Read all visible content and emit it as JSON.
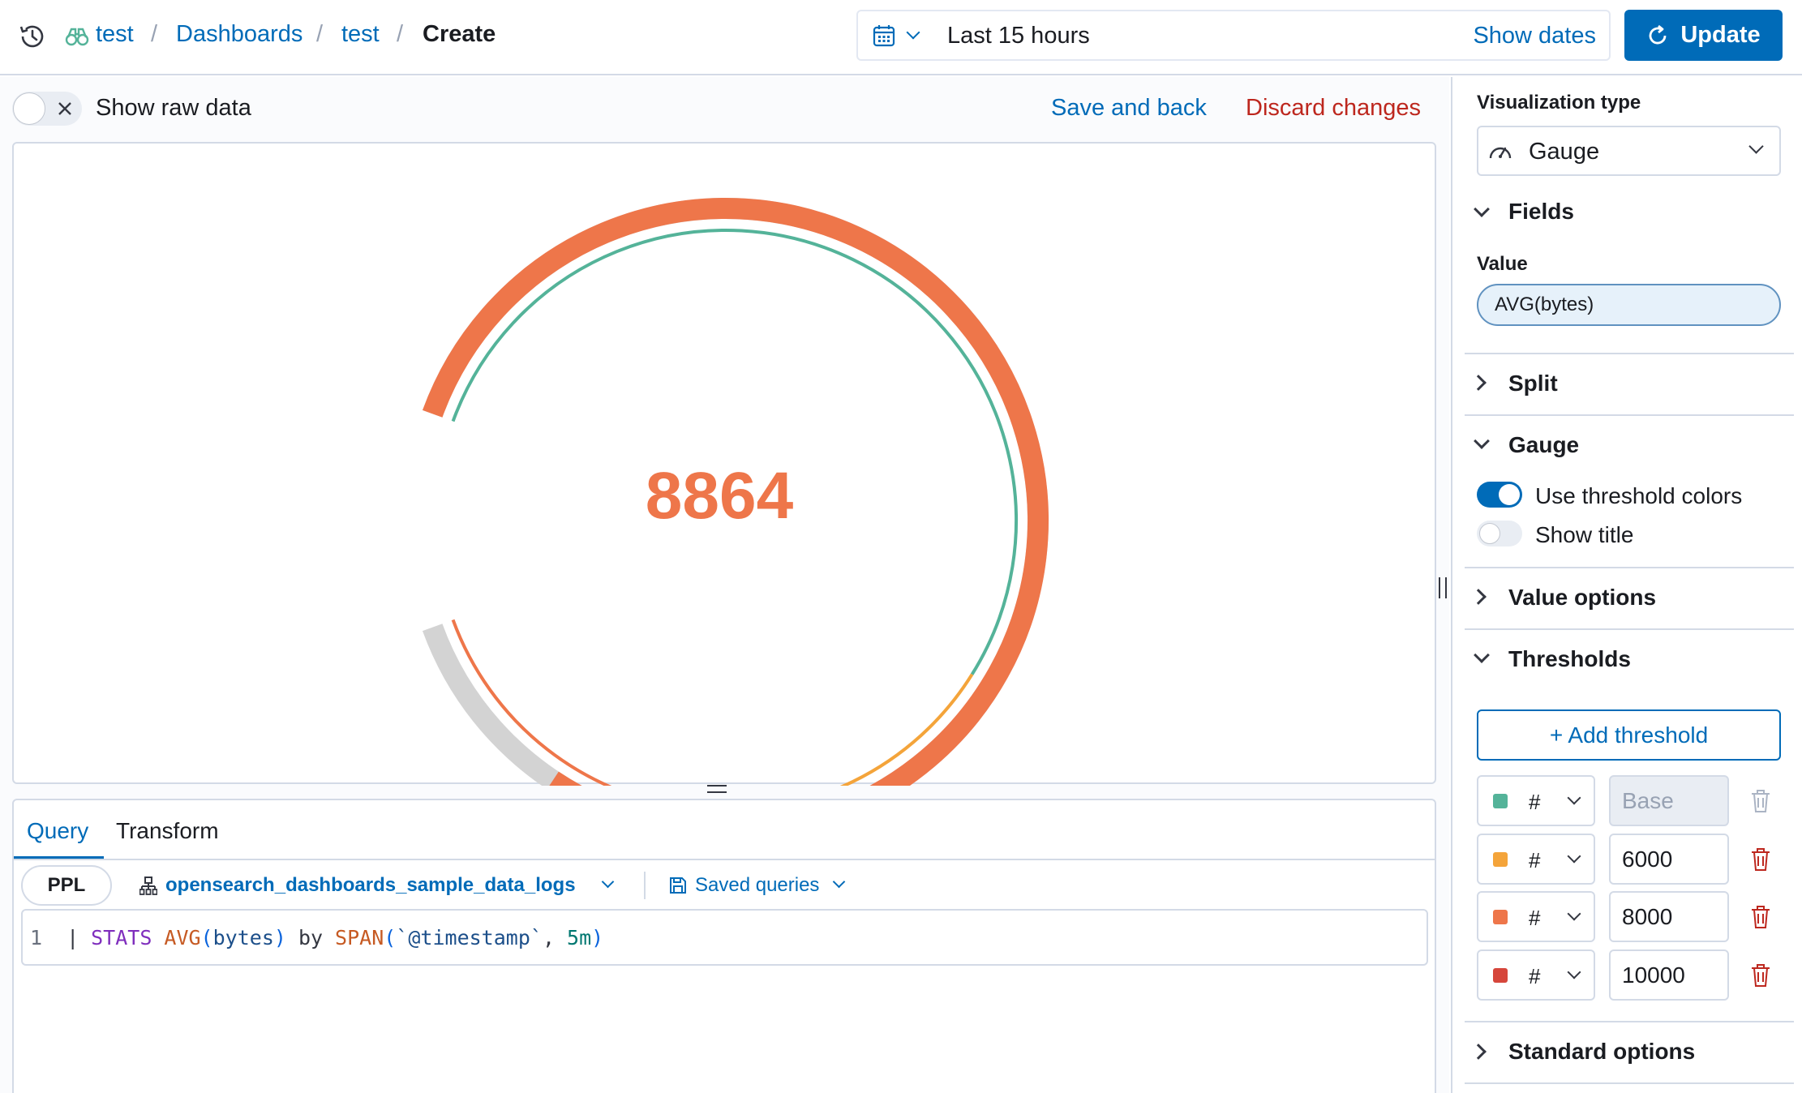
{
  "header": {
    "breadcrumbs": [
      "test",
      "Dashboards",
      "test"
    ],
    "current": "Create",
    "date_range": "Last 15 hours",
    "show_dates_label": "Show dates",
    "update_label": "Update"
  },
  "toolbar": {
    "show_raw_data_label": "Show raw data",
    "save_and_back_label": "Save and back",
    "discard_changes_label": "Discard changes"
  },
  "gauge": {
    "value": 8864,
    "display_value": "8864",
    "min": 0,
    "max": 10000,
    "value_color": "#ee764a",
    "track_color": "#d3d3d3",
    "thresholds": [
      {
        "value": 0,
        "color": "#54b399"
      },
      {
        "value": 6000,
        "color": "#f4a43a"
      },
      {
        "value": 8000,
        "color": "#ee764a"
      },
      {
        "value": 10000,
        "color": "#d6463b"
      }
    ]
  },
  "query": {
    "tabs": [
      "Query",
      "Transform"
    ],
    "active_tab": "Query",
    "language": "PPL",
    "index": "opensearch_dashboards_sample_data_logs",
    "saved_queries_label": "Saved queries",
    "line_number": "1",
    "code": {
      "pipe": "|",
      "kw1": "STATS",
      "fn1": "AVG",
      "p1": "(",
      "arg1": "bytes",
      "p2": ")",
      "by": "by",
      "fn2": "SPAN",
      "p3": "(",
      "field": "`@timestamp`",
      "comma": ",",
      "interval": "5m",
      "p4": ")"
    }
  },
  "sidebar": {
    "vis_type_label": "Visualization type",
    "vis_type_value": "Gauge",
    "fields_title": "Fields",
    "value_label": "Value",
    "value_pill": "AVG(bytes)",
    "split_title": "Split",
    "gauge_title": "Gauge",
    "use_threshold_colors_label": "Use threshold colors",
    "use_threshold_colors_on": true,
    "show_title_label": "Show title",
    "show_title_on": false,
    "value_options_title": "Value options",
    "thresholds_title": "Thresholds",
    "add_threshold_label": "+ Add threshold",
    "threshold_rows": [
      {
        "color": "#54b399",
        "hash": "#",
        "value": "Base",
        "is_base": true
      },
      {
        "color": "#f4a43a",
        "hash": "#",
        "value": "6000",
        "is_base": false
      },
      {
        "color": "#ee764a",
        "hash": "#",
        "value": "8000",
        "is_base": false
      },
      {
        "color": "#d6463b",
        "hash": "#",
        "value": "10000",
        "is_base": false
      }
    ],
    "standard_options_title": "Standard options"
  }
}
